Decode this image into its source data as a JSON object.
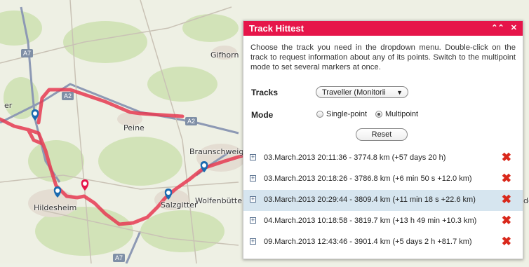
{
  "map": {
    "labels": {
      "gifhorn": "Gifhorn",
      "peine": "Peine",
      "braunschweig": "Braunschweig",
      "wolfenbuettel": "Wolfenbüttel",
      "salzgitter": "Salzgitter",
      "hildesheim": "Hildesheim",
      "er": "er",
      "de": "de"
    },
    "shields": {
      "a7_top": "A7",
      "a2_a": "A2",
      "a2_b": "A2",
      "a7_bottom": "A7"
    },
    "track_color": "#e63a52",
    "marker_color": "#1a6ab0",
    "active_marker_color": "#e6154a"
  },
  "panel": {
    "title": "Track Hittest",
    "collapse_icon": "⌃⌃",
    "close_icon": "✕",
    "description": "Choose the track you need in the dropdown menu. Double-click on the track to request information about any of its points. Switch to the multipoint mode to set several markers at once.",
    "tracks_label": "Tracks",
    "tracks_value": "Traveller (Monitorii",
    "tracks_arrow": "▼",
    "mode_label": "Mode",
    "mode_single": "Single-point",
    "mode_multi": "Multipoint",
    "mode_selected": "Multipoint",
    "reset_label": "Reset",
    "entries": [
      {
        "text": "03.March.2013 20:11:36 - 3774.8 km (+57 days 20 h)",
        "selected": false
      },
      {
        "text": "03.March.2013 20:18:26 - 3786.8 km (+6 min 50 s +12.0 km)",
        "selected": false
      },
      {
        "text": "03.March.2013 20:29:44 - 3809.4 km (+11 min 18 s +22.6 km)",
        "selected": true
      },
      {
        "text": "04.March.2013 10:18:58 - 3819.7 km (+13 h 49 min +10.3 km)",
        "selected": false
      },
      {
        "text": "09.March.2013 12:43:46 - 3901.4 km (+5 days 2 h +81.7 km)",
        "selected": false
      }
    ],
    "expand_icon": "+",
    "delete_icon": "✖"
  }
}
